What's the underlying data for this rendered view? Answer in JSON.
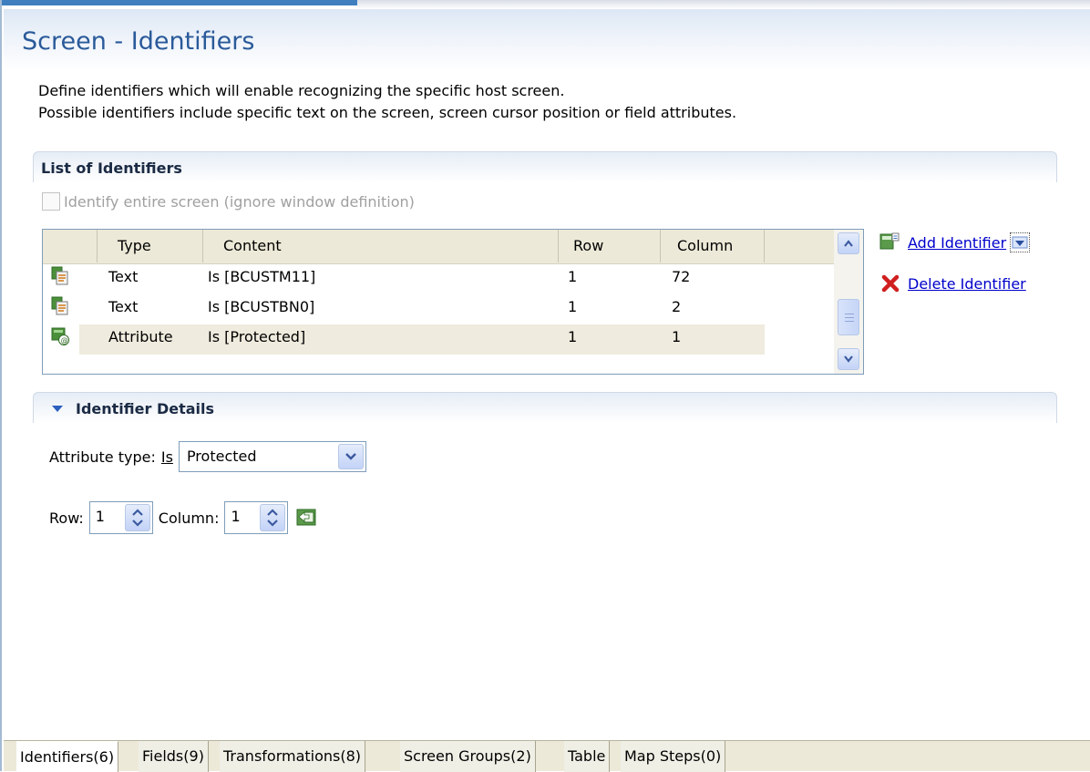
{
  "page": {
    "title": "Screen - Identifiers",
    "description_line1": "Define identifiers which will enable recognizing the specific host screen.",
    "description_line2": "Possible identifiers include specific text on the screen, screen cursor position or field attributes."
  },
  "list_section": {
    "title": "List of Identifiers",
    "checkbox_label": "Identify entire screen (ignore window definition)",
    "checkbox_checked": false,
    "checkbox_enabled": false,
    "columns": [
      "Type",
      "Content",
      "Row",
      "Column"
    ],
    "rows": [
      {
        "icon": "text-identifier-icon",
        "type": "Text",
        "content": "Is [BCUSTM11]",
        "row": "1",
        "column": "72",
        "selected": false
      },
      {
        "icon": "text-identifier-icon",
        "type": "Text",
        "content": "Is [BCUSTBN0]",
        "row": "1",
        "column": "2",
        "selected": false
      },
      {
        "icon": "attribute-identifier-icon",
        "type": "Attribute",
        "content": "Is [Protected]",
        "row": "1",
        "column": "1",
        "selected": true
      }
    ],
    "add_identifier_label": "Add Identifier",
    "delete_identifier_label": "Delete Identifier"
  },
  "details_section": {
    "title": "Identifier Details",
    "attribute_type_label": "Attribute type:",
    "operator_label": "Is",
    "attribute_value": "Protected",
    "row_label": "Row:",
    "row_value": "1",
    "column_label": "Column:",
    "column_value": "1"
  },
  "tabs": [
    {
      "label": "Identifiers(6)",
      "active": true
    },
    {
      "label": "Fields(9)",
      "active": false
    },
    {
      "label": "Transformations(8)",
      "active": false
    },
    {
      "label": "Screen Groups(2)",
      "active": false
    },
    {
      "label": "Table",
      "active": false
    },
    {
      "label": "Map Steps(0)",
      "active": false
    }
  ],
  "colors": {
    "title": "#2a5a9a",
    "link": "#0000cc",
    "selected_row": "#efebde",
    "tab_bar": "#ece9d8"
  }
}
